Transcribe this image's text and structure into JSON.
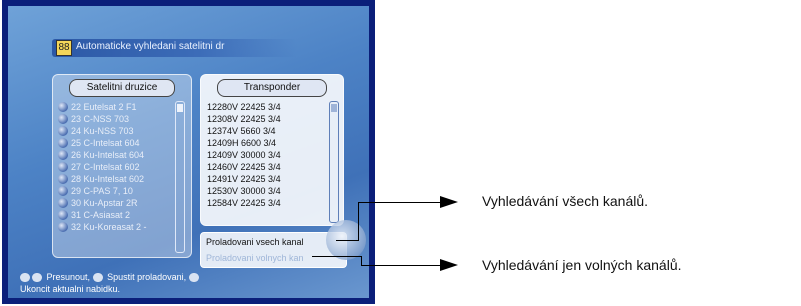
{
  "screen": {
    "title_icon": "88",
    "title": "Automaticke vyhledani satelitni dr"
  },
  "satellites": {
    "header": "Satelitni druzice",
    "items": [
      "22 Eutelsat 2 F1",
      "23 C-NSS 703",
      "24 Ku-NSS 703",
      "25 C-Intelsat 604",
      "26 Ku-Intelsat 604",
      "27 C-Intelsat 602",
      "28 Ku-Intelsat 602",
      "29 C-PAS 7, 10",
      "30 Ku-Apstar 2R",
      "31 C-Asiasat 2",
      "32 Ku-Koreasat 2 -"
    ]
  },
  "transponders": {
    "header": "Transponder",
    "items": [
      "12280V 22425 3/4",
      "12308V 22425 3/4",
      "12374V 5660 3/4",
      "12409H 6600 3/4",
      "12409V 30000 3/4",
      "12460V 22425 3/4",
      "12491V 22425 3/4",
      "12530V 30000 3/4",
      "12584V 22425 3/4"
    ]
  },
  "scan_options": {
    "all": "Proladovani vsech kanal",
    "free": "Proladovani volnych kan"
  },
  "hints": {
    "move": "Presunout,",
    "start": "Spustit proladovani,",
    "exit": "Ukoncit aktualni nabidku."
  },
  "annotations": {
    "all_channels": "Vyhledávání všech kanálů.",
    "free_channels": "Vyhledávání jen volných kanálů."
  }
}
